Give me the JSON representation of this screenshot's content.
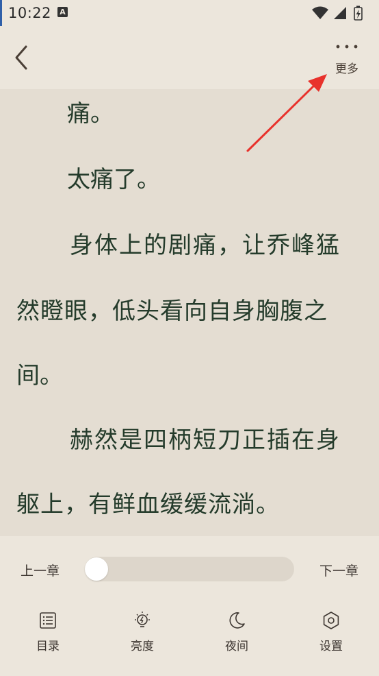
{
  "status_bar": {
    "time": "10:22",
    "notification_icon": "a-icon",
    "icons": [
      "wifi-icon",
      "signal-icon",
      "battery-charging-icon"
    ]
  },
  "header": {
    "back_icon": "chevron-left-icon",
    "more_icon": "more-dots-icon",
    "more_label": "更多"
  },
  "content": {
    "paragraphs": [
      {
        "lines": [
          "痛。"
        ]
      },
      {
        "lines": [
          "太痛了。"
        ]
      },
      {
        "lines": [
          "身体上的剧痛，让乔峰猛",
          "然瞪眼，低头看向自身胸腹之",
          "间。"
        ]
      },
      {
        "lines": [
          "赫然是四柄短刀正插在身",
          "躯上，有鲜血缓缓流淌。"
        ]
      }
    ]
  },
  "chapter_nav": {
    "prev_label": "上一章",
    "next_label": "下一章",
    "progress": 0
  },
  "toolbar": {
    "items": [
      {
        "label": "目录",
        "icon": "list-icon"
      },
      {
        "label": "亮度",
        "icon": "bulb-icon"
      },
      {
        "label": "夜间",
        "icon": "moon-icon"
      },
      {
        "label": "设置",
        "icon": "settings-icon"
      }
    ]
  },
  "colors": {
    "background": "#ece6dc",
    "content_background": "#e4ddd2",
    "text": "#243b2b",
    "annotation_arrow": "#e8322c"
  }
}
